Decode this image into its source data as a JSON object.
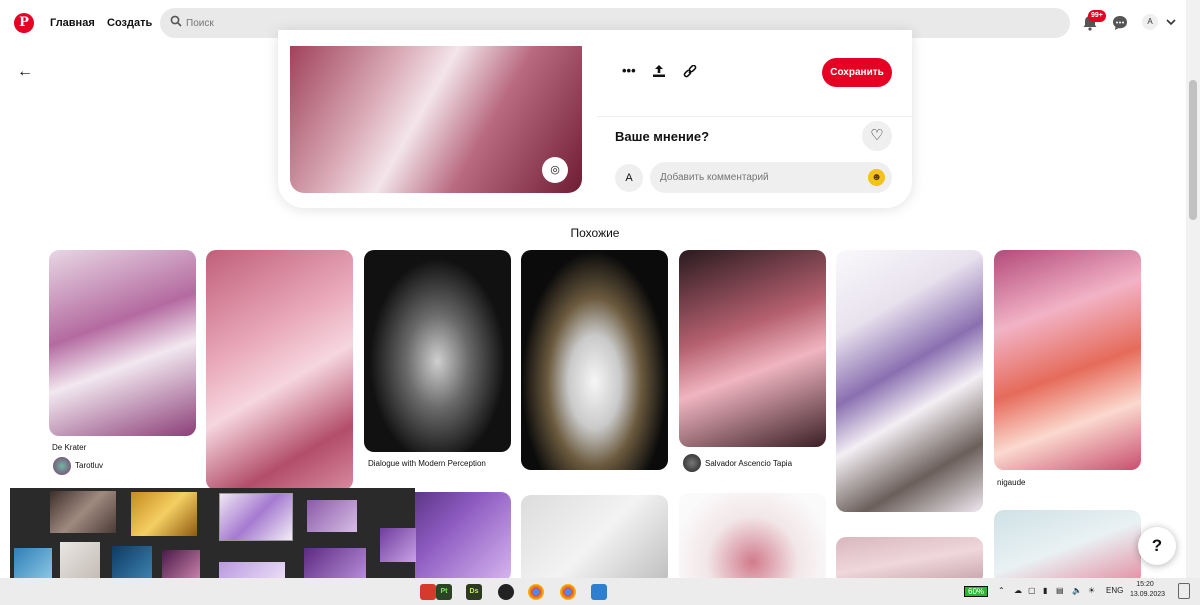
{
  "header": {
    "logo": "P",
    "nav_home": "Главная",
    "nav_create": "Создать",
    "search_placeholder": "Поиск",
    "notif_badge": "99+",
    "avatar_initial": "A"
  },
  "pin": {
    "save_label": "Сохранить",
    "opinion_label": "Ваше мнение?",
    "commenter_initial": "A",
    "comment_placeholder": "Добавить комментарий"
  },
  "more_like_this": {
    "title": "Похожие",
    "pins": [
      {
        "caption": "De Krater",
        "author": "Tarotluv"
      },
      {
        "caption": "Dialogue with Modern Perception"
      },
      {
        "author": "Salvador Ascencio Tapia"
      },
      {
        "caption": "nigaude"
      }
    ]
  },
  "help_label": "?",
  "taskbar": {
    "apps": [
      "Pt",
      "Ds"
    ],
    "battery": "60%",
    "lang": "ENG",
    "time": "15:20",
    "date": "13.09.2023"
  },
  "colors": {
    "brand": "#e60023",
    "search_bg": "#e9e9e9"
  }
}
